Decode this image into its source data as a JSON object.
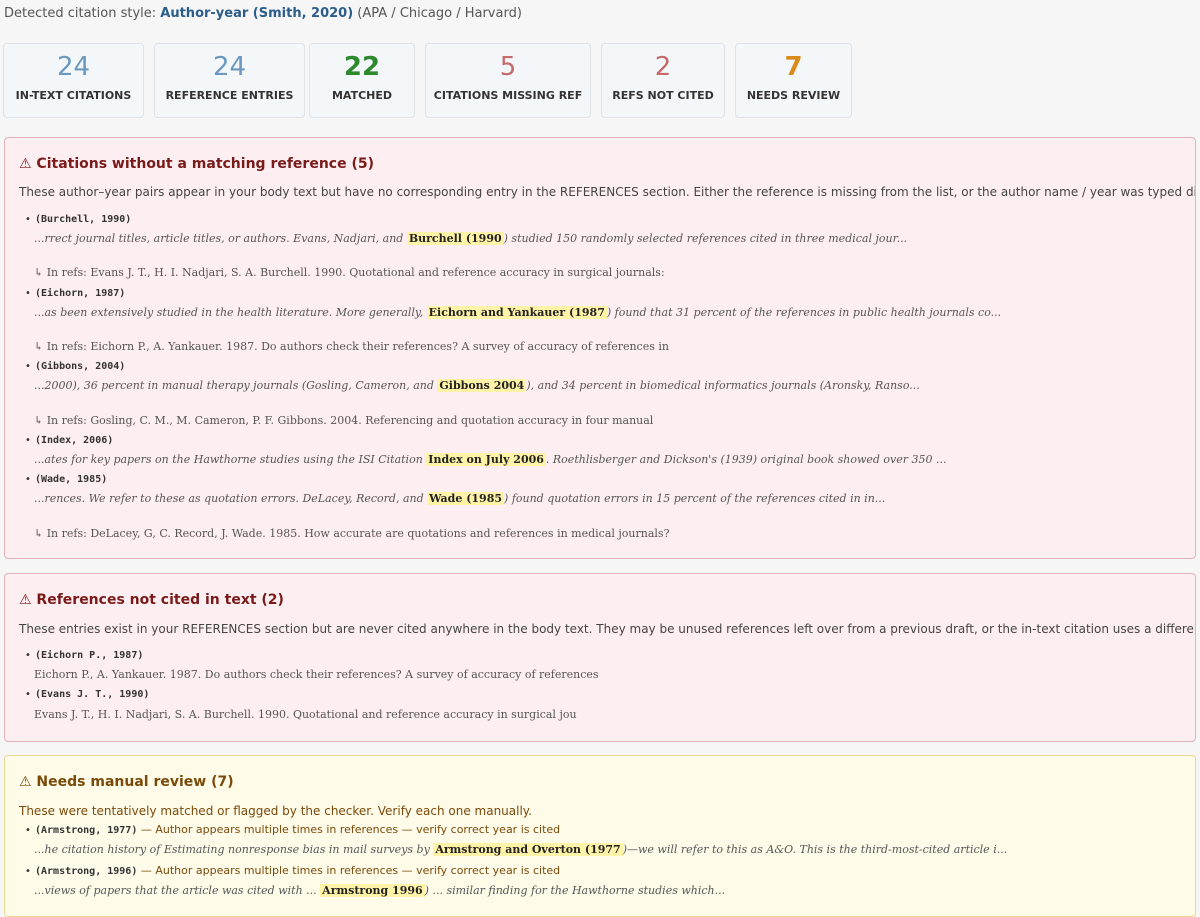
{
  "header": {
    "prefix": "Detected citation style: ",
    "style": "Author-year (Smith, 2020)",
    "suffix": " (APA / Chicago / Harvard)"
  },
  "stats": [
    {
      "value": "24",
      "label": "IN-TEXT CITATIONS",
      "color": "#6c98bf"
    },
    {
      "value": "24",
      "label": "REFERENCE ENTRIES",
      "color": "#6c98bf"
    },
    {
      "value": "22",
      "label": "MATCHED",
      "color": "#2c8a2c"
    },
    {
      "value": "5",
      "label": "CITATIONS MISSING REF",
      "color": "#c46a6a"
    },
    {
      "value": "2",
      "label": "REFS NOT CITED",
      "color": "#c46a6a"
    },
    {
      "value": "7",
      "label": "NEEDS REVIEW",
      "color": "#d98b1c"
    }
  ],
  "missing": {
    "title": "⚠ Citations without a matching reference (5)",
    "desc": "These author–year pairs appear in your body text but have no corresponding entry in the REFERENCES section. Either the reference is missing from the list, or the author name / year was typed differently.",
    "items": [
      {
        "key": "(Burchell, 1990)",
        "ctx_before": "...rrect journal titles, article titles, or authors. Evans, Nadjari, and ",
        "ctx_hl": "Burchell (1990",
        "ctx_after": ") studied 150 randomly selected references cited in three medical jour...",
        "ref": "↳ In refs: Evans J. T., H. I. Nadjari, S. A. Burchell. 1990. Quotational and reference accuracy in surgical journals:"
      },
      {
        "key": "(Eichorn, 1987)",
        "ctx_before": "...as been extensively studied in the health literature. More generally, ",
        "ctx_hl": "Eichorn and Yankauer (1987",
        "ctx_after": ") found that 31 percent of the references in public health journals co...",
        "ref": "↳ In refs: Eichorn P., A. Yankauer. 1987. Do authors check their references? A survey of accuracy of references in"
      },
      {
        "key": "(Gibbons, 2004)",
        "ctx_before": "...2000), 36 percent in manual therapy journals (Gosling, Cameron, and ",
        "ctx_hl": "Gibbons 2004",
        "ctx_after": "), and 34 percent in biomedical informatics journals (Aronsky, Ranso...",
        "ref": "↳ In refs: Gosling, C. M., M. Cameron, P. F. Gibbons. 2004. Referencing and quotation accuracy in four manual"
      },
      {
        "key": "(Index, 2006)",
        "ctx_before": "...ates for key papers on the Hawthorne studies using the ISI Citation ",
        "ctx_hl": "Index on July 2006",
        "ctx_after": ". Roethlisberger and Dickson's (1939) original book showed over 350 ...",
        "ref": ""
      },
      {
        "key": "(Wade, 1985)",
        "ctx_before": "...rences. We refer to these as quotation errors. DeLacey, Record, and ",
        "ctx_hl": "Wade (1985",
        "ctx_after": ") found quotation errors in 15 percent of the references cited in in...",
        "ref": "↳ In refs: DeLacey, G, C. Record, J. Wade. 1985. How accurate are quotations and references in medical journals?"
      }
    ]
  },
  "unused": {
    "title": "⚠ References not cited in text (2)",
    "desc": "These entries exist in your REFERENCES section but are never cited anywhere in the body text. They may be unused references left over from a previous draft, or the in-text citation uses a different spelling / year.",
    "items": [
      {
        "key": "(Eichorn P., 1987)",
        "ref": "Eichorn P., A. Yankauer. 1987. Do authors check their references? A survey of accuracy of references"
      },
      {
        "key": "(Evans J. T., 1990)",
        "ref": "Evans J. T., H. I. Nadjari, S. A. Burchell. 1990. Quotational and reference accuracy in surgical jou"
      }
    ]
  },
  "review": {
    "title": "⚠ Needs manual review (7)",
    "desc": "These were tentatively matched or flagged by the checker. Verify each one manually.",
    "items": [
      {
        "key": "(Armstrong, 1977)",
        "note": " — Author appears multiple times in references — verify correct year is cited",
        "ctx_before": "...he citation history of Estimating nonresponse bias in mail surveys by ",
        "ctx_hl": "Armstrong and Overton (1977",
        "ctx_after": ")—we will refer to this as A&O. This is the third-most-cited article i..."
      },
      {
        "key": "(Armstrong, 1996)",
        "note": " — Author appears multiple times in references — verify correct year is cited",
        "ctx_before": "...views of papers that the article was cited with ... ",
        "ctx_hl": "Armstrong 1996",
        "ctx_after": ") ... similar finding for the Hawthorne studies which..."
      }
    ]
  }
}
